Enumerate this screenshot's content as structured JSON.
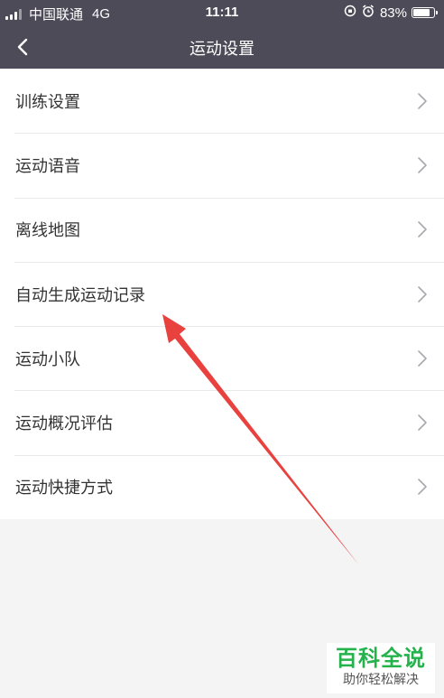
{
  "status_bar": {
    "carrier": "中国联通",
    "network": "4G",
    "time": "11:11",
    "battery": "83%",
    "battery_level": 0.83
  },
  "nav": {
    "title": "运动设置"
  },
  "menu": {
    "items": [
      {
        "label": "训练设置"
      },
      {
        "label": "运动语音"
      },
      {
        "label": "离线地图"
      },
      {
        "label": "自动生成运动记录"
      },
      {
        "label": "运动小队"
      },
      {
        "label": "运动概况评估"
      },
      {
        "label": "运动快捷方式"
      }
    ]
  },
  "annotation": {
    "arrow_color": "#e8413e"
  },
  "watermark": {
    "title": "百科全说",
    "subtitle": "助你轻松解决"
  },
  "colors": {
    "header": "#4e4b58",
    "background": "#f4f4f5",
    "text": "#333333",
    "watermark_green": "#24b24b"
  }
}
